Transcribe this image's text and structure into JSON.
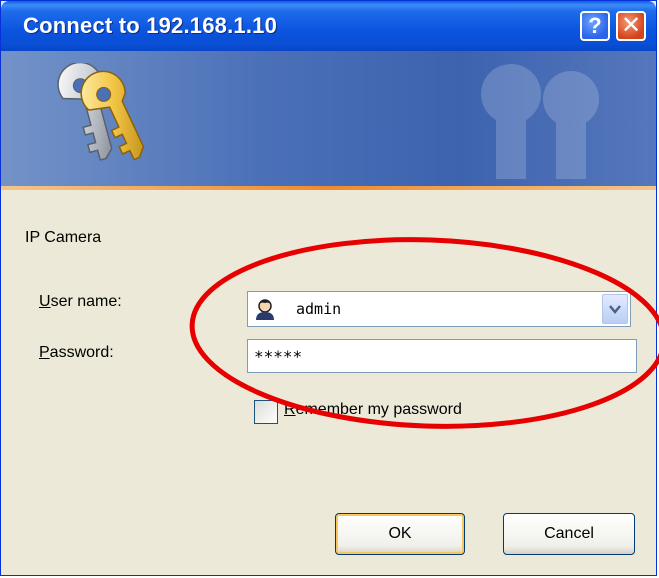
{
  "window": {
    "title": "Connect to 192.168.1.10",
    "help_label": "?",
    "close_label": "✕"
  },
  "prompt": {
    "realm": "IP Camera"
  },
  "form": {
    "username_label_underlined": "U",
    "username_label_rest": "ser name:",
    "username_value": "admin",
    "password_label_underlined": "P",
    "password_label_rest": "assword:",
    "password_value": "*****",
    "remember_label_underlined": "R",
    "remember_label_rest": "emember my password",
    "remember_checked": false
  },
  "buttons": {
    "ok": "OK",
    "cancel": "Cancel"
  },
  "colors": {
    "titlebar": "#0b54de",
    "banner": "#4b70b8",
    "accent_line": "#f08a2b",
    "annotation_circle": "#e60000"
  },
  "icons": {
    "banner": "keys-icon",
    "username": "user-icon",
    "dropdown": "chevron-down-icon"
  }
}
